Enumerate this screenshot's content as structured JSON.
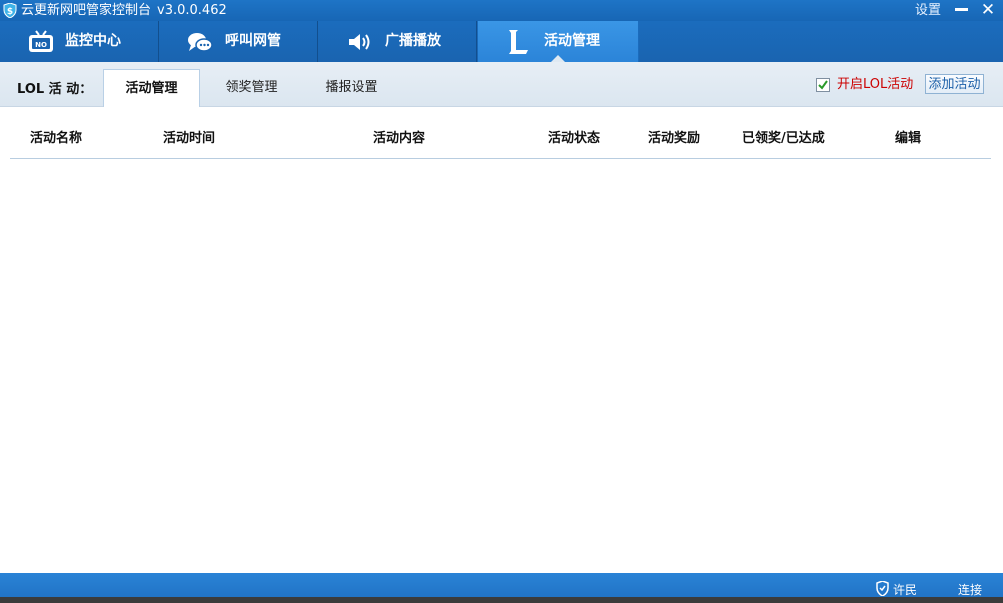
{
  "window": {
    "title": "云更新网吧管家控制台",
    "version": "v3.0.0.462",
    "settings_label": "设置",
    "close_label": "✕"
  },
  "nav": {
    "tabs": [
      {
        "label": "监控中心",
        "icon": "tv-monitor-icon"
      },
      {
        "label": "呼叫网管",
        "icon": "chat-bubble-icon"
      },
      {
        "label": "广播播放",
        "icon": "speaker-icon"
      },
      {
        "label": "活动管理",
        "icon": "lol-logo-icon",
        "active": true
      }
    ]
  },
  "subtabs": {
    "prefix": "LOL 活 动：",
    "items": [
      {
        "label": "活动管理",
        "active": true
      },
      {
        "label": "领奖管理"
      },
      {
        "label": "播报设置"
      }
    ],
    "enable_label": "开启LOL活动",
    "enable_checked": true,
    "add_button": "添加活动"
  },
  "table": {
    "columns": [
      "活动名称",
      "活动时间",
      "活动内容",
      "活动状态",
      "活动奖励",
      "已领奖/已达成",
      "编辑"
    ],
    "rows": []
  },
  "statusbar": {
    "text_1": "许民",
    "text_2": "连接"
  },
  "colors": {
    "accent": "#1a64b0",
    "active_tab": "#2b84d8",
    "enable_text": "#cc0000"
  }
}
